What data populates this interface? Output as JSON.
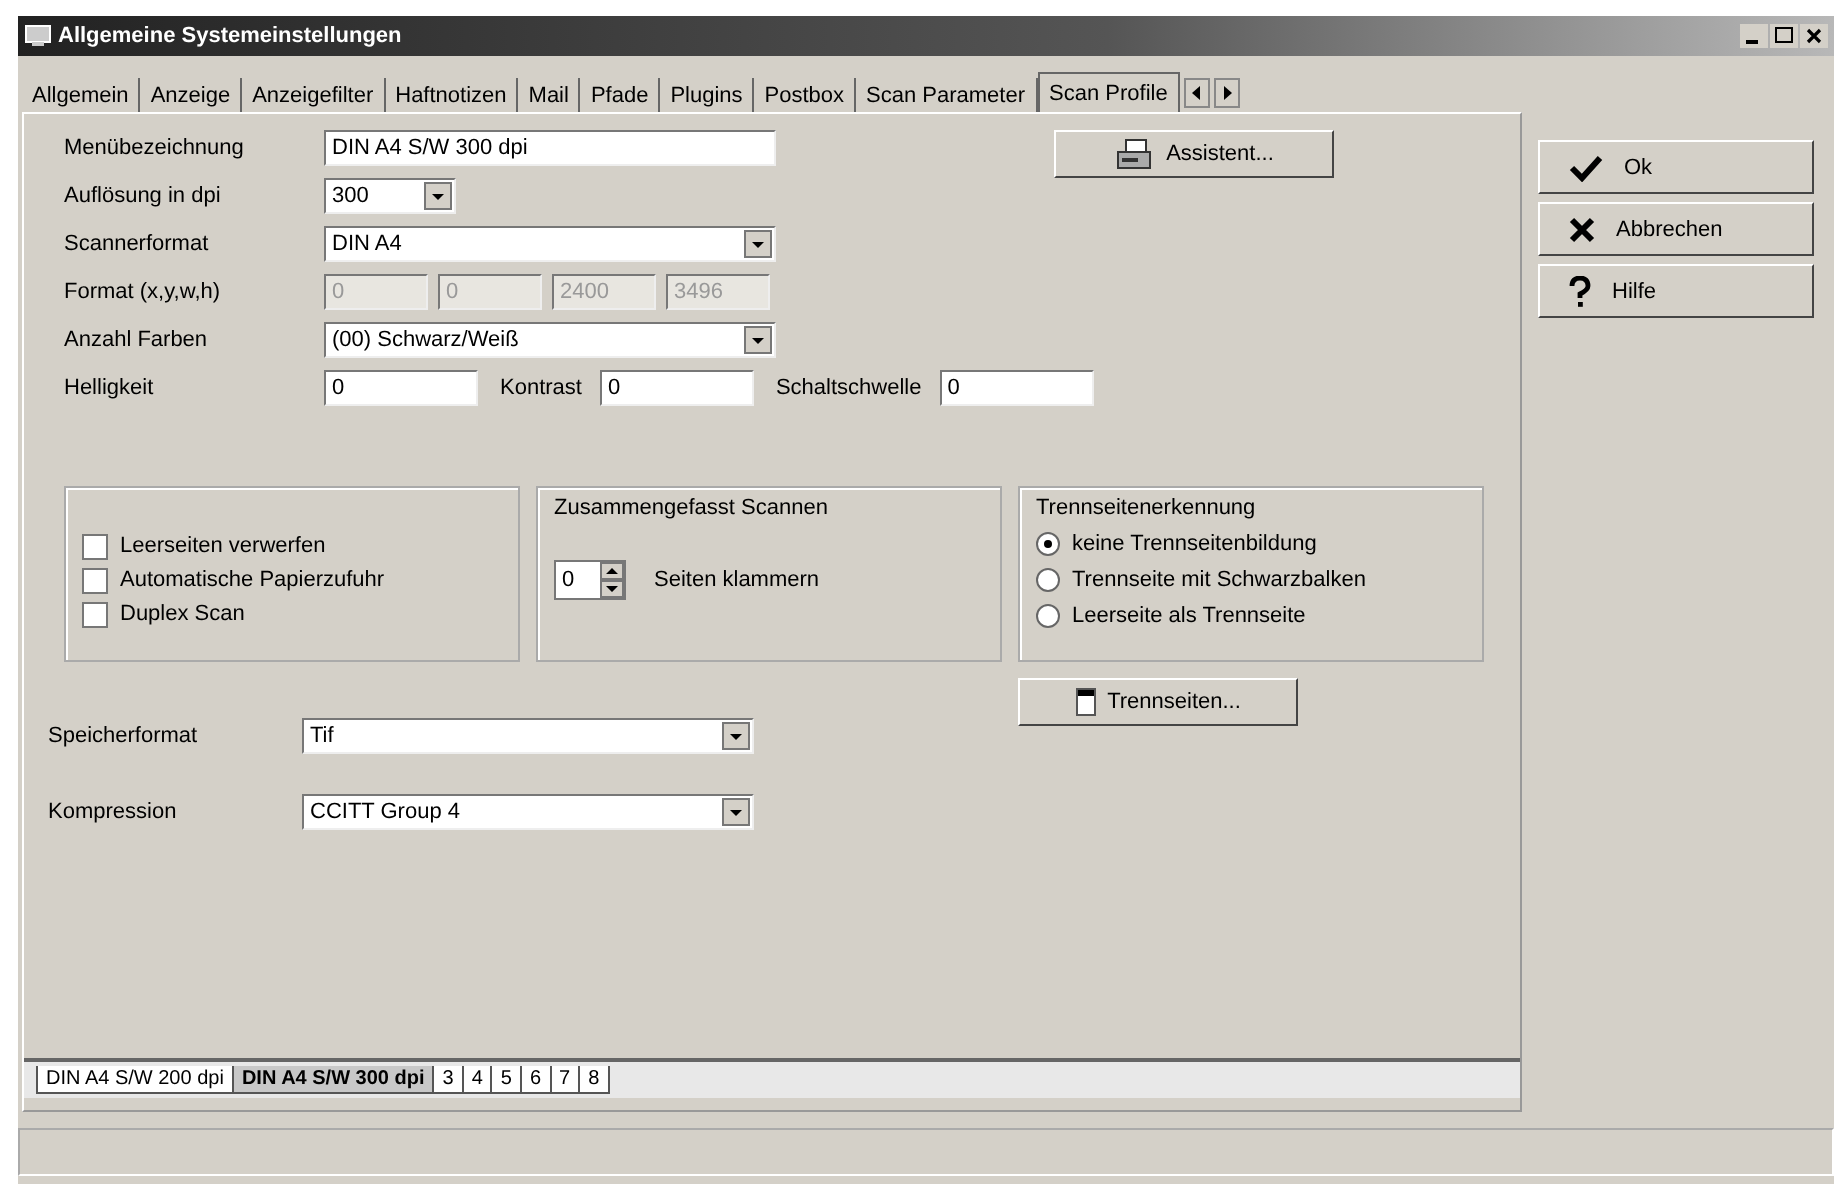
{
  "window": {
    "title": "Allgemeine Systemeinstellungen"
  },
  "tabs": [
    {
      "label": "Allgemein",
      "selected": false
    },
    {
      "label": "Anzeige",
      "selected": false
    },
    {
      "label": "Anzeigefilter",
      "selected": false
    },
    {
      "label": "Haftnotizen",
      "selected": false
    },
    {
      "label": "Mail",
      "selected": false
    },
    {
      "label": "Pfade",
      "selected": false
    },
    {
      "label": "Plugins",
      "selected": false
    },
    {
      "label": "Postbox",
      "selected": false
    },
    {
      "label": "Scan Parameter",
      "selected": false
    },
    {
      "label": "Scan Profile",
      "selected": true
    }
  ],
  "form": {
    "menu_name": {
      "label": "Menübezeichnung",
      "value": "DIN A4 S/W 300 dpi"
    },
    "resolution": {
      "label": "Auflösung in dpi",
      "value": "300"
    },
    "scan_format": {
      "label": "Scannerformat",
      "value": "DIN A4"
    },
    "format": {
      "label": "Format (x,y,w,h)",
      "disabled": true,
      "values": [
        "0",
        "0",
        "2400",
        "3496"
      ]
    },
    "colors": {
      "label": "Anzahl Farben",
      "value": "(00) Schwarz/Weiß"
    },
    "levels": [
      {
        "label": "Helligkeit",
        "value": "0"
      },
      {
        "label": "Kontrast",
        "value": "0"
      },
      {
        "label": "Schaltschwelle",
        "value": "0"
      }
    ]
  },
  "assistant_button": "Assistent...",
  "options": [
    {
      "label": "Leerseiten verwerfen",
      "checked": false
    },
    {
      "label": "Automatische Papierzufuhr",
      "checked": false
    },
    {
      "label": "Duplex Scan",
      "checked": false
    }
  ],
  "combined": {
    "title": "Zusammengefasst Scannen",
    "value": "0",
    "label": "Seiten klammern"
  },
  "separator": {
    "title": "Trennseitenerkennung",
    "options": [
      {
        "label": "keine Trennseitenbildung",
        "selected": true
      },
      {
        "label": "Trennseite mit Schwarzbalken",
        "selected": false
      },
      {
        "label": "Leerseite als Trennseite",
        "selected": false
      }
    ]
  },
  "separator_button": "Trennseiten...",
  "storage": [
    {
      "label": "Speicherformat",
      "value": "Tif"
    },
    {
      "label": "Kompression",
      "value": "CCITT Group 4"
    }
  ],
  "profiles": [
    {
      "label": "DIN A4 S/W 200 dpi",
      "selected": false
    },
    {
      "label": "DIN A4 S/W 300 dpi",
      "selected": true
    },
    {
      "label": "3",
      "selected": false
    },
    {
      "label": "4",
      "selected": false
    },
    {
      "label": "5",
      "selected": false
    },
    {
      "label": "6",
      "selected": false
    },
    {
      "label": "7",
      "selected": false
    },
    {
      "label": "8",
      "selected": false
    }
  ],
  "side_buttons": [
    {
      "label": "Ok",
      "kind": "ok"
    },
    {
      "label": "Abbrechen",
      "kind": "cancel"
    },
    {
      "label": "Hilfe",
      "kind": "help"
    }
  ]
}
